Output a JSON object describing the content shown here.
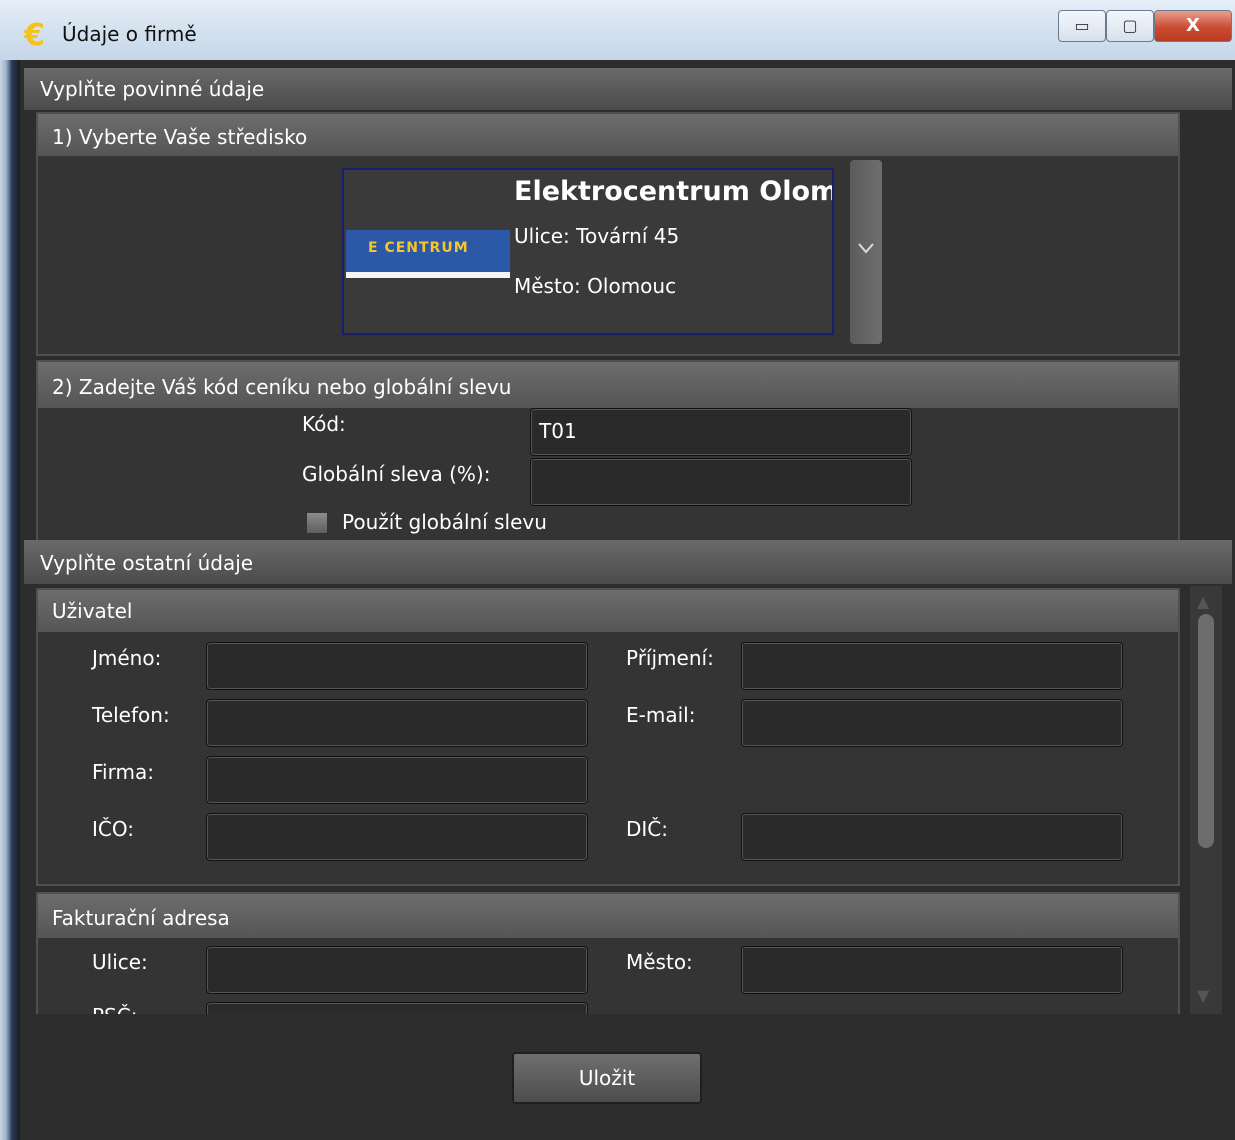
{
  "window": {
    "title": "Údaje o firmě",
    "icon": "euro-icon",
    "icon_glyph": "€",
    "minimize_glyph": "▭",
    "maximize_glyph": "▢",
    "close_glyph": "X"
  },
  "required": {
    "header": "Vyplňte povinné údaje",
    "store_group": {
      "header": "1) Vyberte Vaše středisko",
      "selected_store": {
        "logo_text": "E CENTRUM",
        "name": "Elektrocentrum Olomouc",
        "street": "Ulice: Tovární 45",
        "city": "Město: Olomouc"
      }
    },
    "pricing_group": {
      "header": "2) Zadejte Váš kód ceníku nebo globální slevu",
      "code_label": "Kód:",
      "code_value": "T01",
      "discount_label": "Globální sleva (%):",
      "discount_value": "",
      "use_discount_label": "Použít globální slevu",
      "use_discount_checked": false
    }
  },
  "other": {
    "header": "Vyplňte ostatní údaje",
    "user_group": {
      "header": "Uživatel",
      "first_name_label": "Jméno:",
      "last_name_label": "Příjmení:",
      "phone_label": "Telefon:",
      "email_label": "E-mail:",
      "company_label": "Firma:",
      "ico_label": "IČO:",
      "dic_label": "DIČ:"
    },
    "billing_group": {
      "header": "Fakturační adresa",
      "street_label": "Ulice:",
      "city_label": "Město:",
      "zip_label": "PSČ:"
    }
  },
  "actions": {
    "save_label": "Uložit"
  },
  "colors": {
    "background": "#2b2b2b",
    "header": "#5a5a5a",
    "selection_border": "#1b1e6a",
    "logo_blue": "#2c58a8"
  }
}
